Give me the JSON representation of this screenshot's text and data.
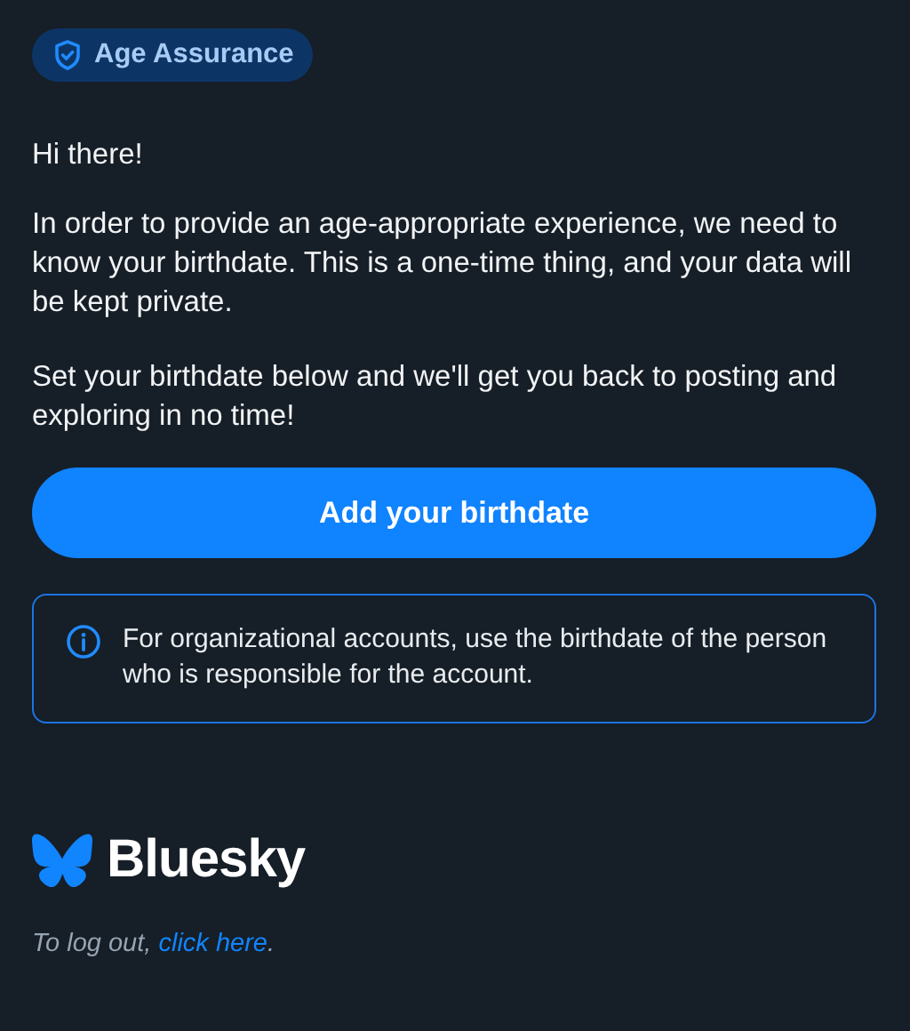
{
  "badge": {
    "label": "Age Assurance"
  },
  "greeting": "Hi there!",
  "paragraphs": [
    "In order to provide an age-appropriate experience, we need to know your birthdate. This is a one-time thing, and your data will be kept private.",
    "Set your birthdate below and we'll get you back to posting and exploring in no time!"
  ],
  "primary_button": {
    "label": "Add your birthdate"
  },
  "notice": {
    "text": "For organizational accounts, use the birthdate of the person who is responsible for the account."
  },
  "logo": {
    "wordmark": "Bluesky"
  },
  "logout": {
    "prefix": "To log out, ",
    "link": "click here",
    "suffix": "."
  }
}
